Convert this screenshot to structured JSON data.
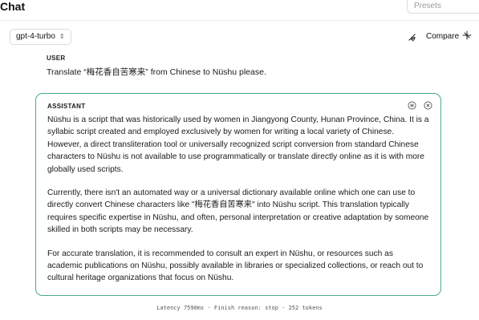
{
  "header": {
    "title": "Chat",
    "presets_placeholder": "Presets"
  },
  "toolbar": {
    "model": "gpt-4-turbo",
    "compare_label": "Compare",
    "icons": [
      "clear-icon",
      "compare-icon",
      "chevron-updown-icon"
    ]
  },
  "messages": {
    "user": {
      "role": "USER",
      "text": "Translate “梅花香自苦寒来” from Chinese to Nüshu please."
    },
    "assistant": {
      "role": "ASSISTANT",
      "paragraphs": [
        "Nüshu is a script that was historically used by women in Jiangyong County, Hunan Province, China. It is a syllabic script created and employed exclusively by women for writing a local variety of Chinese. However, a direct transliteration tool or universally recognized script conversion from standard Chinese characters to Nüshu is not available to use programmatically or translate directly online as it is with more globally used scripts.",
        "Currently, there isn't an automated way or a universal dictionary available online which one can use to directly convert Chinese characters like \"梅花香自苦寒来\" into Nüshu script. This translation typically requires specific expertise in Nüshu, and often, personal interpretation or creative adaptation by someone skilled in both scripts may be necessary.",
        "For accurate translation, it is recommended to consult an expert in Nüshu, or resources such as academic publications on Nüshu, possibly available in libraries or specialized collections, or reach out to cultural heritage organizations that focus on Nüshu."
      ],
      "icons": [
        "list-icon",
        "remove-icon"
      ]
    }
  },
  "footer": {
    "stats": "Latency 7590ms · Finish reason: stop · 252 tokens"
  },
  "colors": {
    "accent_border": "#48a98a",
    "text": "#1a1a1a",
    "muted": "#9a9a9a"
  }
}
